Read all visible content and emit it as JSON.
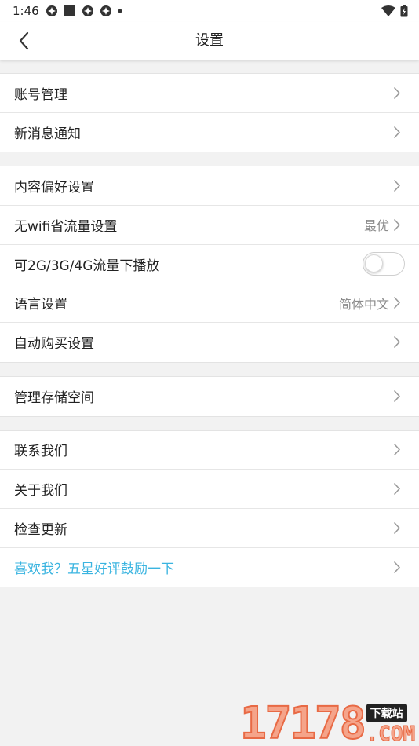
{
  "status_bar": {
    "time": "1:46",
    "icons": [
      "app-icon",
      "square-icon",
      "app-icon",
      "app-icon",
      "dot-icon",
      "wifi-icon",
      "battery-icon"
    ]
  },
  "nav": {
    "title": "设置",
    "back_icon": "chevron-left-icon"
  },
  "groups": [
    {
      "items": [
        {
          "label": "账号管理"
        },
        {
          "label": "新消息通知"
        }
      ]
    },
    {
      "items": [
        {
          "label": "内容偏好设置"
        },
        {
          "label": "无wifi省流量设置",
          "value": "最优"
        },
        {
          "label": "可2G/3G/4G流量下播放",
          "toggle": false
        },
        {
          "label": "语言设置",
          "value": "简体中文"
        },
        {
          "label": "自动购买设置"
        }
      ]
    },
    {
      "items": [
        {
          "label": "管理存储空间"
        }
      ]
    },
    {
      "items": [
        {
          "label": "联系我们"
        },
        {
          "label": "关于我们"
        },
        {
          "label": "检查更新"
        },
        {
          "label": "喜欢我？五星好评鼓励一下",
          "accent": "#3ab4e0"
        }
      ]
    }
  ],
  "watermark": {
    "number": "17178",
    "badge": "下载站",
    "suffix": ".COM"
  },
  "colors": {
    "accent": "#3ab4e0",
    "background": "#f2f2f2",
    "secondary_text": "#8c8c8c"
  }
}
